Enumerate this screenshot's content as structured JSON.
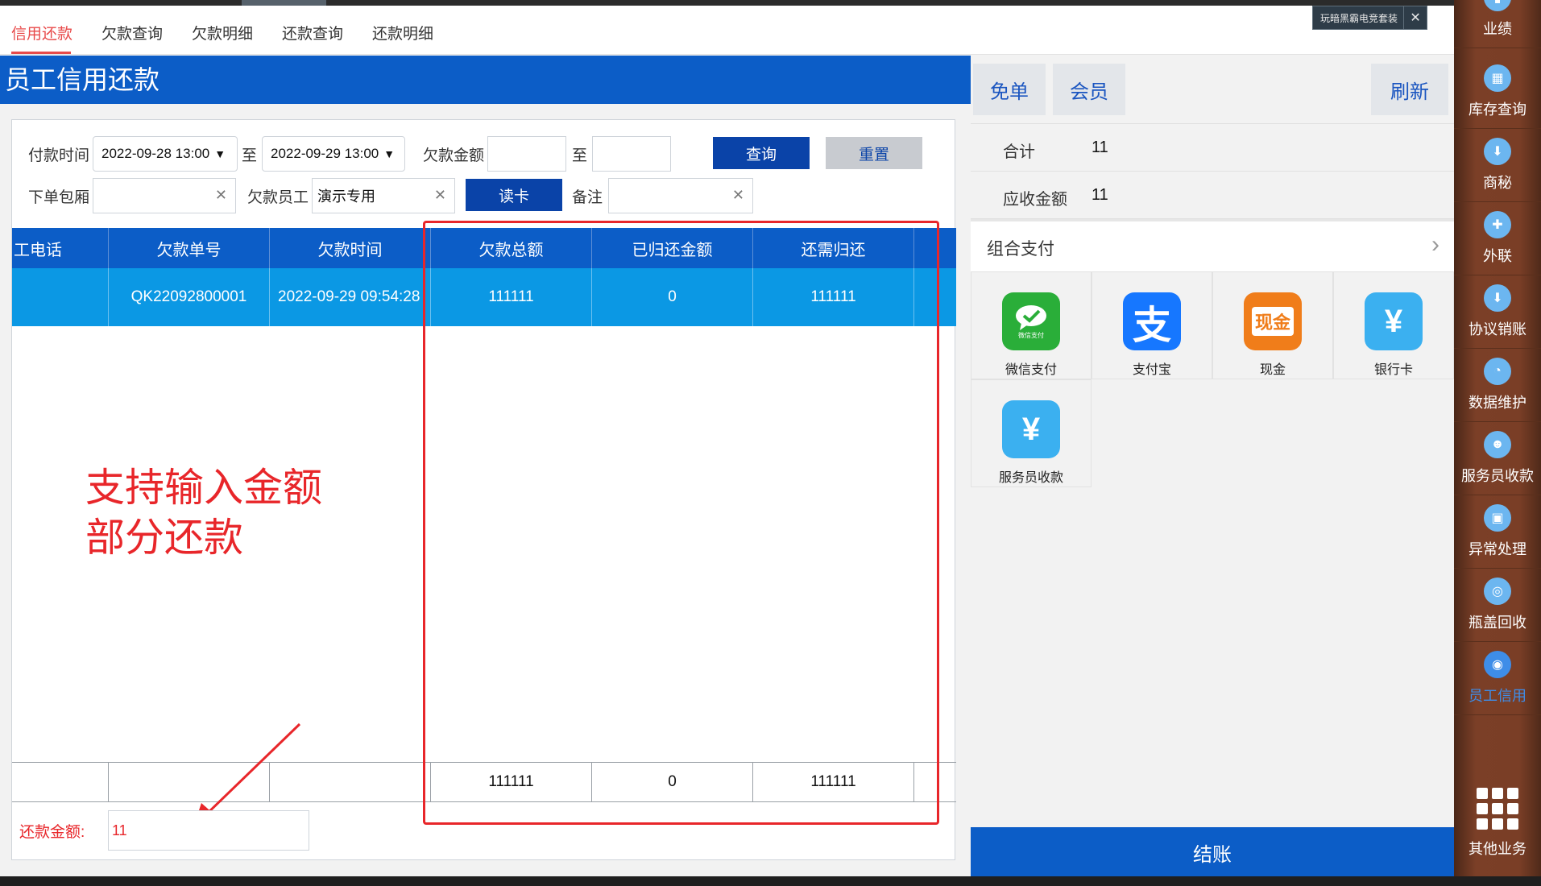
{
  "tabs": [
    {
      "label": "信用还款",
      "active": true
    },
    {
      "label": "欠款查询",
      "active": false
    },
    {
      "label": "欠款明细",
      "active": false
    },
    {
      "label": "还款查询",
      "active": false
    },
    {
      "label": "还款明细",
      "active": false
    }
  ],
  "banner": {
    "text": "玩暗黑霸电竞套装",
    "close": "✕"
  },
  "page_title": "员工信用还款",
  "filters": {
    "pay_time_label": "付款时间",
    "pay_time_from": "2022-09-28 13:00",
    "to_label": "至",
    "pay_time_to": "2022-09-29 13:00",
    "debt_amount_label": "欠款金额",
    "debt_amount_from": "",
    "debt_amount_to": "",
    "query_button": "查询",
    "reset_button": "重置",
    "room_label": "下单包厢",
    "room_value": "",
    "debt_staff_label": "欠款员工",
    "debt_staff_value": "演示专用",
    "read_card_button": "读卡",
    "remark_label": "备注",
    "remark_value": ""
  },
  "table": {
    "headers": [
      "工电话",
      "欠款单号",
      "欠款时间",
      "欠款总额",
      "已归还金额",
      "还需归还"
    ],
    "rows": [
      [
        "",
        "QK22092800001",
        "2022-09-29 09:54:28",
        "111111",
        "0",
        "111111"
      ]
    ],
    "totals": [
      "",
      "",
      "",
      "111111",
      "0",
      "111111"
    ]
  },
  "annotation": {
    "line1": "支持输入金额",
    "line2": "部分还款"
  },
  "repay": {
    "label": "还款金额:",
    "value": "11"
  },
  "right_panel": {
    "free_button": "免单",
    "member_button": "会员",
    "refresh_button": "刷新",
    "total_label": "合计",
    "total_value": "11",
    "receivable_label": "应收金额",
    "receivable_value": "11",
    "combo_pay_label": "组合支付",
    "payments": [
      {
        "name": "微信支付",
        "icon": "wechat-pay-icon",
        "color": "#2aae39",
        "sub": "微信支付"
      },
      {
        "name": "支付宝",
        "icon": "alipay-icon",
        "color": "#1677ff",
        "glyph": "支"
      },
      {
        "name": "现金",
        "icon": "cash-icon",
        "color": "#f07d1a",
        "glyph": "现金"
      },
      {
        "name": "银行卡",
        "icon": "bank-card-icon",
        "color": "#3bb0f0",
        "glyph": "¥"
      },
      {
        "name": "服务员收款",
        "icon": "waiter-collect-icon",
        "color": "#3bb0f0",
        "glyph": "¥"
      }
    ],
    "settle_button": "结账"
  },
  "sidebar": {
    "items": [
      {
        "label": "业绩",
        "icon": "performance-icon"
      },
      {
        "label": "库存查询",
        "icon": "inventory-icon"
      },
      {
        "label": "商秘",
        "icon": "download-icon"
      },
      {
        "label": "外联",
        "icon": "contact-icon"
      },
      {
        "label": "协议销账",
        "icon": "agreement-icon"
      },
      {
        "label": "数据维护",
        "icon": "pie-icon"
      },
      {
        "label": "服务员收款",
        "icon": "waiter-icon"
      },
      {
        "label": "异常处理",
        "icon": "box-icon"
      },
      {
        "label": "瓶盖回收",
        "icon": "bottle-icon"
      },
      {
        "label": "员工信用",
        "icon": "credit-icon",
        "active": true
      }
    ],
    "more_label": "其他业务"
  },
  "colors": {
    "accent": "#0c5dc7",
    "active_tab": "#e84a4a",
    "annotation": "#e8262a",
    "selected_row": "#0b98e4"
  }
}
